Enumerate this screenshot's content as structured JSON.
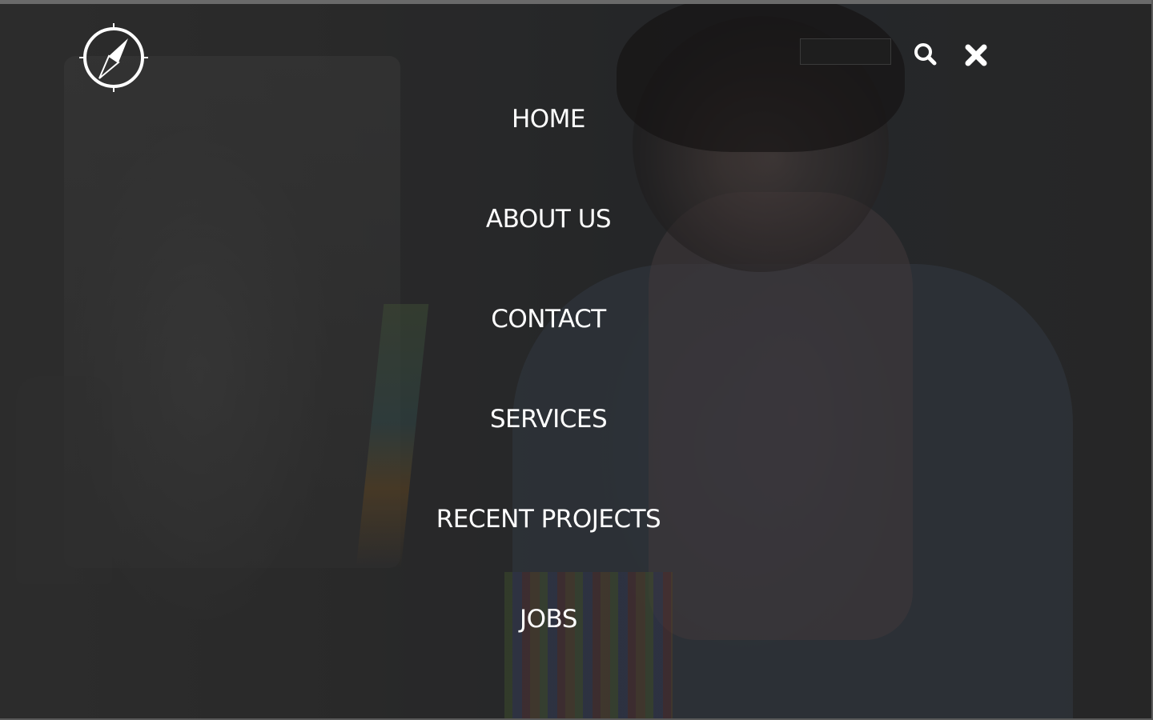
{
  "header": {
    "logo_icon": "compass-icon",
    "search": {
      "placeholder": "",
      "value": "",
      "icon": "search-icon"
    },
    "close": {
      "icon": "close-icon"
    }
  },
  "menu": {
    "items": [
      {
        "label": "HOME"
      },
      {
        "label": "ABOUT US"
      },
      {
        "label": "CONTACT"
      },
      {
        "label": "SERVICES"
      },
      {
        "label": "RECENT PROJECTS"
      },
      {
        "label": "JOBS"
      }
    ]
  },
  "colors": {
    "text": "#ffffff",
    "overlay": "#141414"
  }
}
